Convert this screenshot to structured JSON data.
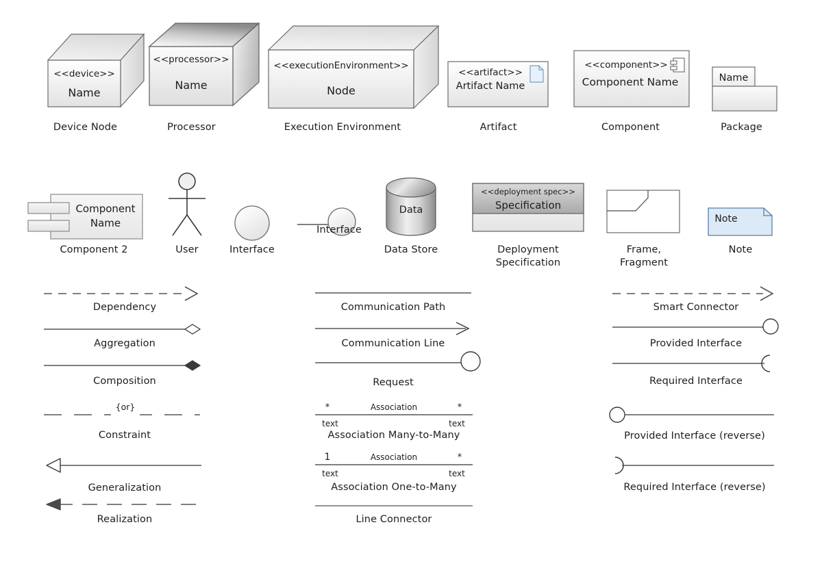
{
  "colors": {
    "stroke": "#6b6b6b",
    "stroke_dark": "#4a4a4a",
    "line": "#555555",
    "text": "#1d1d1d",
    "fill_light_top": "#ffffff",
    "fill_light_bottom": "#e4e4e4",
    "fill_gray_top": "#d9d9d9",
    "fill_gray_bottom": "#a8a8a8",
    "note_fill": "#dce9f7",
    "note_stroke": "#5a7fa8",
    "artifact_icon_fill": "#e8f0fa",
    "artifact_icon_stroke": "#7a9ec4"
  },
  "shapes": {
    "device_node": {
      "stereotype": "<<device>>",
      "name": "Name",
      "caption": "Device Node"
    },
    "processor": {
      "stereotype": "<<processor>>",
      "name": "Name",
      "caption": "Processor"
    },
    "execution_environment": {
      "stereotype": "<<executionEnvironment>>",
      "name": "Node",
      "caption": "Execution Environment"
    },
    "artifact": {
      "stereotype": "<<artifact>>",
      "name": "Artifact Name",
      "caption": "Artifact",
      "icon": "document-icon"
    },
    "component": {
      "stereotype": "<<component>>",
      "name": "Component Name",
      "caption": "Component",
      "icon": "component-icon"
    },
    "package": {
      "name": "Name",
      "caption": "Package"
    },
    "component2": {
      "name": "Component\nName",
      "caption": "Component 2"
    },
    "user": {
      "caption": "User",
      "icon": "actor-stick-figure-icon"
    },
    "interface_ball": {
      "caption": "Interface"
    },
    "interface_lollipop": {
      "caption": "Interface"
    },
    "data_store": {
      "name": "Data",
      "caption": "Data Store"
    },
    "deployment_spec": {
      "stereotype": "<<deployment spec>>",
      "name": "Specification",
      "caption": "Deployment\nSpecification"
    },
    "frame_fragment": {
      "caption": "Frame,\nFragment"
    },
    "note": {
      "name": "Note",
      "caption": "Note"
    }
  },
  "connectors": {
    "column_left": [
      {
        "key": "dependency",
        "caption": "Dependency"
      },
      {
        "key": "aggregation",
        "caption": "Aggregation"
      },
      {
        "key": "composition",
        "caption": "Composition"
      },
      {
        "key": "constraint",
        "caption": "Constraint",
        "mid_label": "{or}"
      },
      {
        "key": "generalization",
        "caption": "Generalization"
      },
      {
        "key": "realization",
        "caption": "Realization"
      }
    ],
    "column_middle": [
      {
        "key": "communication_path",
        "caption": "Communication Path"
      },
      {
        "key": "communication_line",
        "caption": "Communication Line"
      },
      {
        "key": "request",
        "caption": "Request"
      },
      {
        "key": "association_many_to_many",
        "caption": "Association Many-to-Many",
        "label": "Association",
        "mult_left": "*",
        "mult_right": "*",
        "role_left": "text",
        "role_right": "text"
      },
      {
        "key": "association_one_to_many",
        "caption": "Association One-to-Many",
        "label": "Association",
        "mult_left": "1",
        "mult_right": "*",
        "role_left": "text",
        "role_right": "text"
      },
      {
        "key": "line_connector",
        "caption": "Line Connector"
      }
    ],
    "column_right": [
      {
        "key": "smart_connector",
        "caption": "Smart Connector"
      },
      {
        "key": "provided_interface",
        "caption": "Provided Interface"
      },
      {
        "key": "required_interface",
        "caption": "Required Interface"
      },
      {
        "key": "provided_interface_reverse",
        "caption": "Provided Interface (reverse)"
      },
      {
        "key": "required_interface_reverse",
        "caption": "Required Interface (reverse)"
      }
    ]
  }
}
